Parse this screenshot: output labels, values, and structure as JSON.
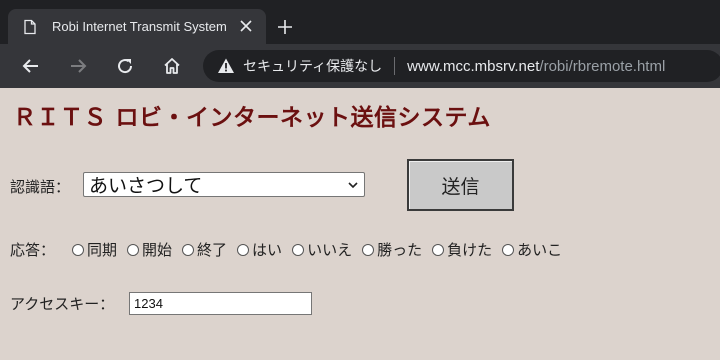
{
  "browser": {
    "tab_title": "Robi Internet Transmit System",
    "security_label": "セキュリティ保護なし",
    "url_host": "www.mcc.mbsrv.net",
    "url_path": "/robi/rbremote.html",
    "icons": [
      "page-icon",
      "close-icon",
      "plus-icon",
      "back-arrow-icon",
      "forward-arrow-icon",
      "reload-icon",
      "home-icon",
      "warning-icon"
    ]
  },
  "page": {
    "title": "ＲＩＴＳ ロビ・インターネット送信システム",
    "recognition": {
      "label": "認識語：",
      "selected": "あいさつして"
    },
    "send_button": "送信",
    "response": {
      "label": "応答：",
      "options": [
        "同期",
        "開始",
        "終了",
        "はい",
        "いいえ",
        "勝った",
        "負けた",
        "あいこ"
      ]
    },
    "access_key": {
      "label": "アクセスキー：",
      "value": "1234"
    },
    "colors": {
      "title": "#6b1010",
      "background": "#dcd3cd"
    }
  }
}
